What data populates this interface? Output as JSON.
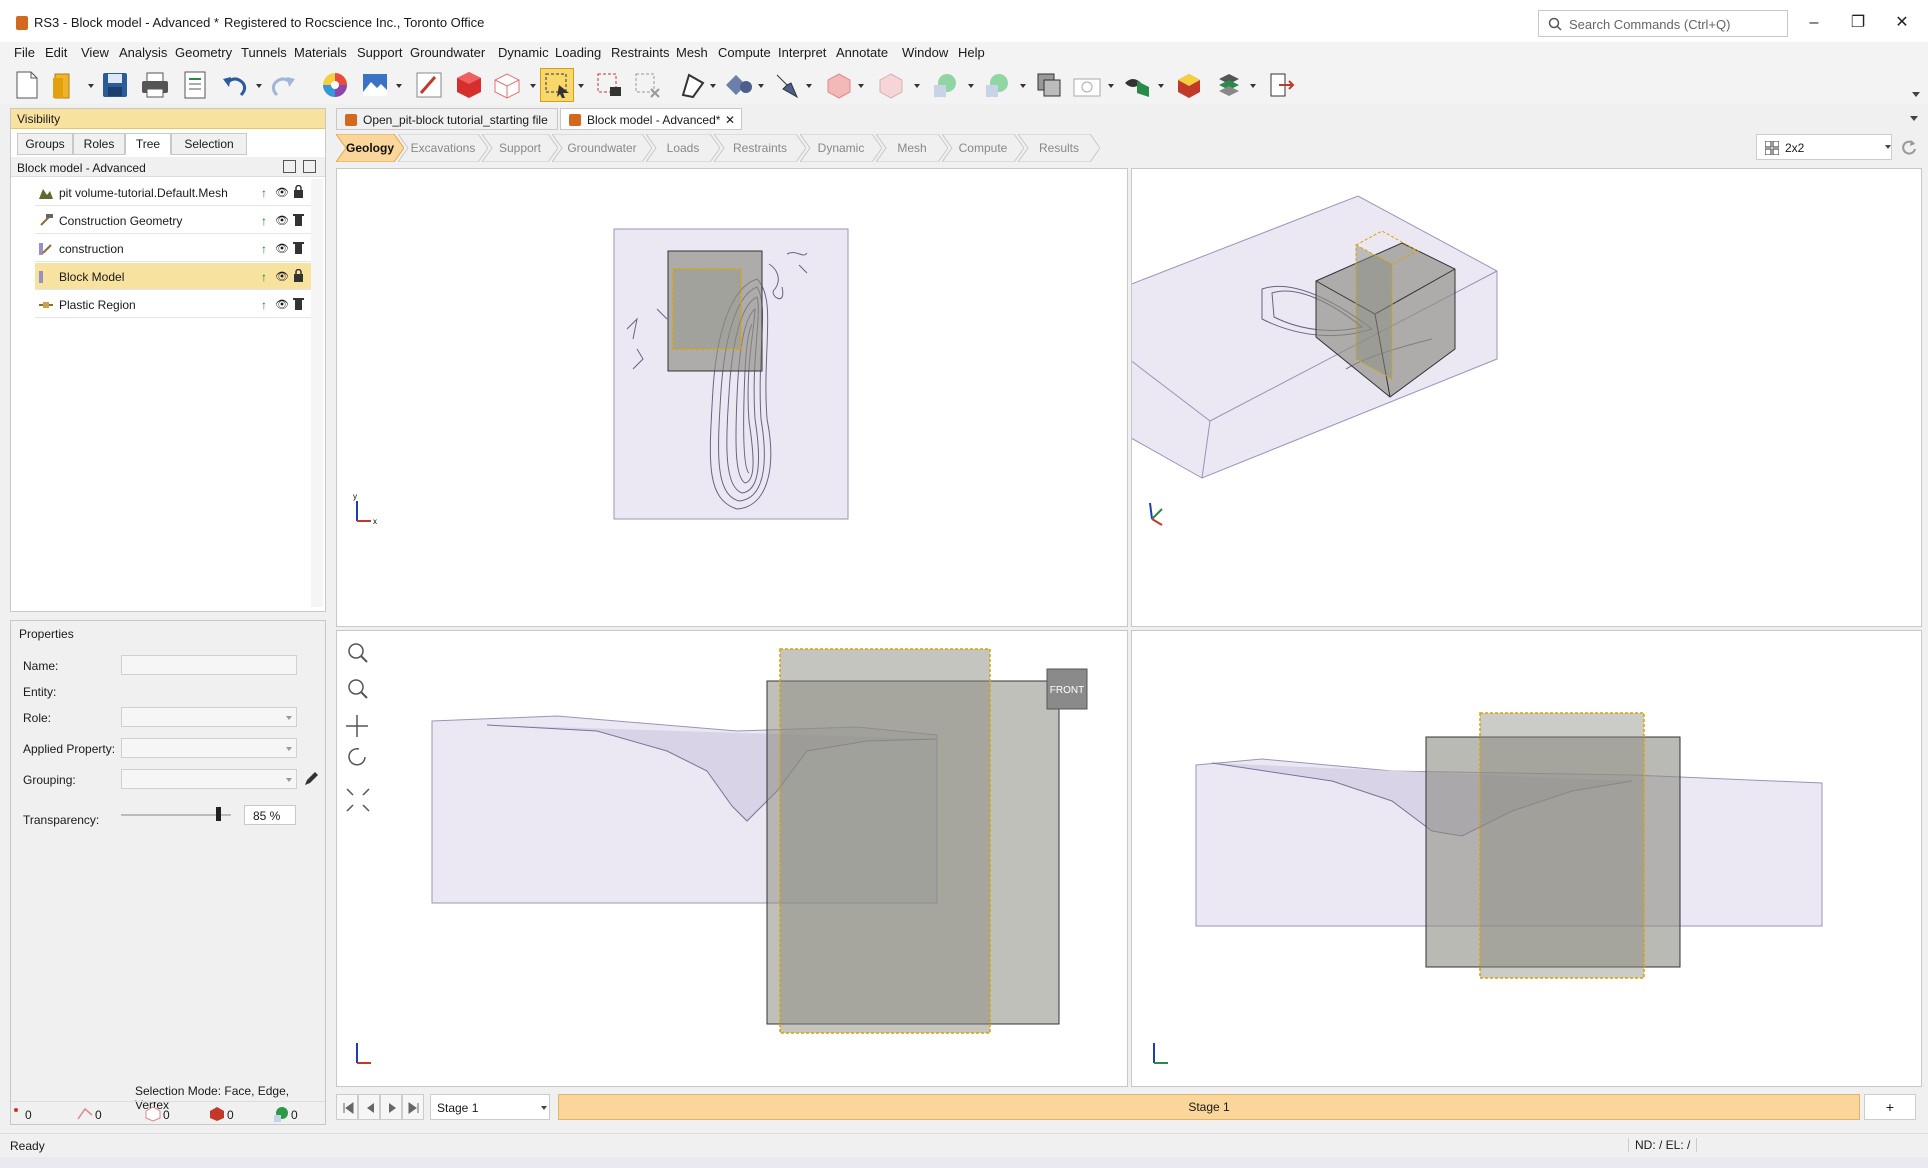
{
  "window": {
    "title": "RS3 - Block model - Advanced *",
    "registration": "Registered to Rocscience Inc., Toronto Office",
    "search_placeholder": "Search Commands (Ctrl+Q)"
  },
  "menu": [
    "File",
    "Edit",
    "View",
    "Analysis",
    "Geometry",
    "Tunnels",
    "Materials",
    "Support",
    "Groundwater",
    "Dynamic",
    "Loading",
    "Restraints",
    "Mesh",
    "Compute",
    "Interpret",
    "Annotate",
    "Window",
    "Help"
  ],
  "toolbar_icons": [
    "new-file-icon",
    "open-folder-icon",
    "save-icon",
    "print-icon",
    "report-icon",
    "undo-icon",
    "redo-icon",
    "color-wheel-icon",
    "image-icon",
    "pick-icon",
    "red-cube-icon",
    "box-select-icon",
    "selection-rect-icon",
    "lock-select-icon",
    "deselect-icon",
    "draw-icon",
    "shapes-icon",
    "tool-icon",
    "extrude-icon",
    "cube-faded-icon",
    "sphere-icon",
    "sphere-add-icon",
    "copy-icon",
    "camera-icon",
    "visibility-icon",
    "material-cube-icon",
    "layers-icon",
    "exit-icon"
  ],
  "left_panel": {
    "header": "Visibility",
    "tabs": [
      "Groups",
      "Roles",
      "Tree",
      "Selection"
    ],
    "active_tab": "Tree",
    "model_title": "Block model - Advanced",
    "tree": [
      {
        "label": "pit volume-tutorial.Default.Mesh",
        "selected": false
      },
      {
        "label": "Construction Geometry",
        "selected": false
      },
      {
        "label": "construction",
        "selected": false
      },
      {
        "label": "Block Model",
        "selected": true
      },
      {
        "label": "Plastic Region",
        "selected": false
      }
    ]
  },
  "properties": {
    "header": "Properties",
    "labels": {
      "name": "Name:",
      "entity": "Entity:",
      "role": "Role:",
      "applied": "Applied Property:",
      "grouping": "Grouping:",
      "transparency": "Transparency:"
    },
    "transparency_value": "85 %",
    "transparency_fraction": 0.85,
    "selection_mode": "Selection Mode:  Face, Edge, Vertex",
    "counts": [
      "0",
      "0",
      "0",
      "0",
      "0"
    ]
  },
  "doc_tabs": [
    {
      "label": "Open_pit-block tutorial_starting file",
      "active": false
    },
    {
      "label": "Block model - Advanced*",
      "active": true
    }
  ],
  "workflow_steps": [
    "Geology",
    "Excavations",
    "Support",
    "Groundwater",
    "Loads",
    "Restraints",
    "Dynamic",
    "Mesh",
    "Compute",
    "Results"
  ],
  "active_step": "Geology",
  "layout": "2x2",
  "viewcube_label": "FRONT",
  "stage": {
    "selected": "Stage 1",
    "bar_label": "Stage 1",
    "add": "+"
  },
  "status": {
    "text": "Ready",
    "nd": "ND: /  EL: /"
  },
  "colors": {
    "accent": "#f8e2a0",
    "stage": "#fbd69b",
    "block": "#8c8c82",
    "volume": "#e4dff0",
    "dashed": "#d9a300"
  }
}
